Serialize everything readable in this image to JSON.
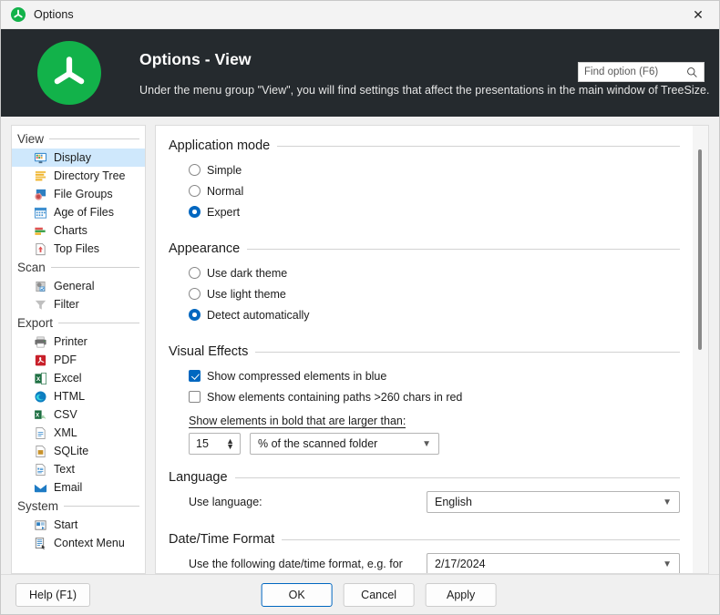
{
  "window": {
    "title": "Options",
    "app_icon": "treesize-logo-icon",
    "close_label": "✕"
  },
  "header": {
    "title": "Options - View",
    "subtitle": "Under the menu group \"View\", you will find settings that affect the presentations in the main window of TreeSize.",
    "logo": "treesize-logo-icon",
    "search": {
      "placeholder": "Find option (F6)",
      "value": "",
      "icon": "search-icon"
    }
  },
  "sidebar": {
    "groups": [
      {
        "label": "View",
        "items": [
          {
            "label": "Display",
            "icon": "monitor-icon",
            "selected": true
          },
          {
            "label": "Directory Tree",
            "icon": "list-icon",
            "selected": false
          },
          {
            "label": "File Groups",
            "icon": "file-groups-icon",
            "selected": false
          },
          {
            "label": "Age of Files",
            "icon": "calendar-icon",
            "selected": false
          },
          {
            "label": "Charts",
            "icon": "bar-chart-icon",
            "selected": false
          },
          {
            "label": "Top Files",
            "icon": "upload-file-icon",
            "selected": false
          }
        ]
      },
      {
        "label": "Scan",
        "items": [
          {
            "label": "General",
            "icon": "gear-clipboard-icon",
            "selected": false
          },
          {
            "label": "Filter",
            "icon": "funnel-icon",
            "selected": false
          }
        ]
      },
      {
        "label": "Export",
        "items": [
          {
            "label": "Printer",
            "icon": "printer-icon",
            "selected": false
          },
          {
            "label": "PDF",
            "icon": "pdf-icon",
            "selected": false
          },
          {
            "label": "Excel",
            "icon": "excel-icon",
            "selected": false
          },
          {
            "label": "HTML",
            "icon": "edge-html-icon",
            "selected": false
          },
          {
            "label": "CSV",
            "icon": "csv-icon",
            "selected": false
          },
          {
            "label": "XML",
            "icon": "xml-file-icon",
            "selected": false
          },
          {
            "label": "SQLite",
            "icon": "sqlite-icon",
            "selected": false
          },
          {
            "label": "Text",
            "icon": "text-file-icon",
            "selected": false
          },
          {
            "label": "Email",
            "icon": "email-icon",
            "selected": false
          }
        ]
      },
      {
        "label": "System",
        "items": [
          {
            "label": "Start",
            "icon": "start-icon",
            "selected": false
          },
          {
            "label": "Context Menu",
            "icon": "context-menu-icon",
            "selected": false
          }
        ]
      }
    ]
  },
  "main": {
    "application_mode": {
      "title": "Application mode",
      "options": [
        {
          "label": "Simple",
          "checked": false
        },
        {
          "label": "Normal",
          "checked": false
        },
        {
          "label": "Expert",
          "checked": true
        }
      ]
    },
    "appearance": {
      "title": "Appearance",
      "options": [
        {
          "label": "Use dark theme",
          "checked": false
        },
        {
          "label": "Use light theme",
          "checked": false
        },
        {
          "label": "Detect automatically",
          "checked": true
        }
      ]
    },
    "visual_effects": {
      "title": "Visual Effects",
      "checkboxes": [
        {
          "label": "Show compressed elements in blue",
          "checked": true
        },
        {
          "label": "Show elements containing paths >260 chars in red",
          "checked": false
        }
      ],
      "bold_label": "Show elements in bold that are larger than:",
      "bold_value": "15",
      "bold_unit": "% of the scanned folder"
    },
    "language": {
      "title": "Language",
      "label": "Use language:",
      "value": "English"
    },
    "datetime": {
      "title": "Date/Time Format",
      "label": "Use the following date/time format, e.g. for",
      "value": "2/17/2024"
    }
  },
  "footer": {
    "help": "Help (F1)",
    "ok": "OK",
    "cancel": "Cancel",
    "apply": "Apply"
  },
  "colors": {
    "brand_green": "#12b24a",
    "header_dark": "#252a2e",
    "accent_blue": "#0067c0",
    "selection_blue": "#cfe8fc"
  }
}
